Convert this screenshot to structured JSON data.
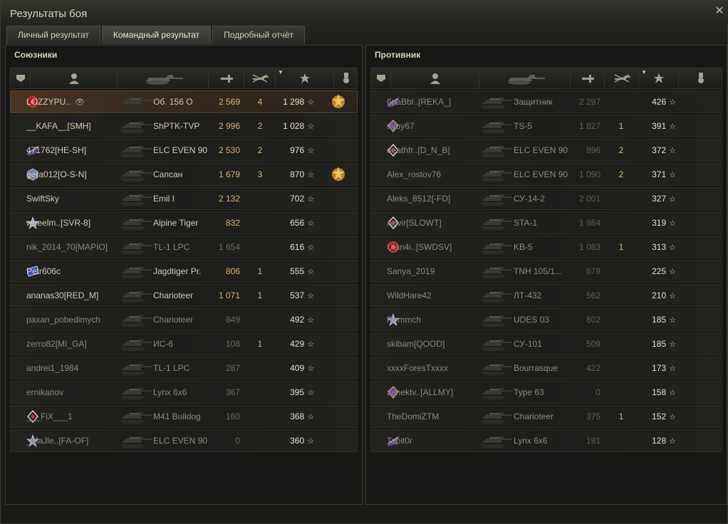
{
  "window": {
    "title": "Результаты боя",
    "close_icon": "✕"
  },
  "tabs": [
    {
      "label": "Личный результат",
      "active": false
    },
    {
      "label": "Командный результат",
      "active": true
    },
    {
      "label": "Подробный отчёт",
      "active": false
    }
  ],
  "allies": {
    "title": "Союзники",
    "rows": [
      {
        "badge": "clan-emblem-red",
        "player": "LOZZYPU..",
        "eye": true,
        "vehicle": "Об. 156 О",
        "damage": "2 569",
        "kills": "4",
        "xp": "1 298",
        "medal": true,
        "highlight": true,
        "dead": false
      },
      {
        "badge": "",
        "player": "__KAFA__[SMH]",
        "eye": false,
        "vehicle": "ShPTK-TVP",
        "damage": "2 996",
        "kills": "2",
        "xp": "1 028",
        "medal": false,
        "highlight": false,
        "dead": false
      },
      {
        "badge": "clan-emblem-wing",
        "player": "471762[HE-SH]",
        "eye": false,
        "vehicle": "ELC EVEN 90",
        "damage": "2 530",
        "kills": "2",
        "xp": "976",
        "medal": false,
        "highlight": false,
        "dead": false
      },
      {
        "badge": "clan-emblem-cube",
        "player": "gera012[O-S-N]",
        "eye": false,
        "vehicle": "Сапсан",
        "damage": "1 679",
        "kills": "3",
        "xp": "870",
        "medal": true,
        "highlight": false,
        "dead": false
      },
      {
        "badge": "",
        "player": "SwiftSky",
        "eye": false,
        "vehicle": "Emil I",
        "damage": "2 132",
        "kills": "",
        "xp": "702",
        "medal": false,
        "highlight": false,
        "dead": false
      },
      {
        "badge": "clan-emblem-star",
        "player": "wheelm..[SVR-8]",
        "eye": false,
        "vehicle": "Alpine Tiger",
        "damage": "832",
        "kills": "",
        "xp": "656",
        "medal": false,
        "highlight": false,
        "dead": false
      },
      {
        "badge": "",
        "player": "nik_2014_70[MAPIO]",
        "eye": false,
        "vehicle": "TL-1 LPC",
        "damage": "1 654",
        "kills": "",
        "xp": "616",
        "medal": false,
        "highlight": false,
        "dead": true
      },
      {
        "badge": "clan-emblem-flag",
        "player": "Petr606c",
        "eye": false,
        "vehicle": "Jagdtiger Pr.",
        "damage": "806",
        "kills": "1",
        "xp": "555",
        "medal": false,
        "highlight": false,
        "dead": false
      },
      {
        "badge": "",
        "player": "ananas30[RED_M]",
        "eye": false,
        "vehicle": "Charioteer",
        "damage": "1 071",
        "kills": "1",
        "xp": "537",
        "medal": false,
        "highlight": false,
        "dead": false
      },
      {
        "badge": "",
        "player": "paxan_pobedimych",
        "eye": false,
        "vehicle": "Charioteer",
        "damage": "849",
        "kills": "",
        "xp": "492",
        "medal": false,
        "highlight": false,
        "dead": true
      },
      {
        "badge": "",
        "player": "zerro82[MI_GA]",
        "eye": false,
        "vehicle": "ИС-6",
        "damage": "108",
        "kills": "1",
        "xp": "429",
        "medal": false,
        "highlight": false,
        "dead": true
      },
      {
        "badge": "",
        "player": "andrei1_1984",
        "eye": false,
        "vehicle": "TL-1 LPC",
        "damage": "287",
        "kills": "",
        "xp": "409",
        "medal": false,
        "highlight": false,
        "dead": true
      },
      {
        "badge": "",
        "player": "ernikanov",
        "eye": false,
        "vehicle": "Lynx 6x6",
        "damage": "367",
        "kills": "",
        "xp": "395",
        "medal": false,
        "highlight": false,
        "dead": true
      },
      {
        "badge": "clan-emblem-diamond",
        "player": "___FiX___1",
        "eye": false,
        "vehicle": "M41 Bulldog",
        "damage": "160",
        "kills": "",
        "xp": "368",
        "medal": false,
        "highlight": false,
        "dead": true
      },
      {
        "badge": "clan-emblem-star",
        "player": "_MaJle..[FA-OF]",
        "eye": false,
        "vehicle": "ELC EVEN 90",
        "damage": "0",
        "kills": "",
        "xp": "360",
        "medal": false,
        "highlight": false,
        "dead": true
      }
    ]
  },
  "enemies": {
    "title": "Противник",
    "rows": [
      {
        "badge": "clan-emblem-wing",
        "player": "6paBbl..[REKA_]",
        "eye": false,
        "vehicle": "Защитник",
        "damage": "2 297",
        "kills": "",
        "xp": "426",
        "medal": false,
        "highlight": false,
        "dead": true
      },
      {
        "badge": "clan-emblem-rank",
        "player": "uyuy67",
        "eye": false,
        "vehicle": "TS-5",
        "damage": "1 827",
        "kills": "1",
        "xp": "391",
        "medal": false,
        "highlight": false,
        "dead": true
      },
      {
        "badge": "clan-emblem-diamond",
        "player": "deathfr..[D_N_B]",
        "eye": false,
        "vehicle": "ELC EVEN 90",
        "damage": "896",
        "kills": "2",
        "xp": "372",
        "medal": false,
        "highlight": false,
        "dead": true
      },
      {
        "badge": "",
        "player": "Alex_rostov76",
        "eye": false,
        "vehicle": "ELC EVEN 90",
        "damage": "1 090",
        "kills": "2",
        "xp": "371",
        "medal": false,
        "highlight": false,
        "dead": true
      },
      {
        "badge": "",
        "player": "Aleks_8512[-FD]",
        "eye": false,
        "vehicle": "СУ-14-2",
        "damage": "2 001",
        "kills": "",
        "xp": "327",
        "medal": false,
        "highlight": false,
        "dead": true
      },
      {
        "badge": "clan-emblem-diamond",
        "player": "Agvir[SLOWT]",
        "eye": false,
        "vehicle": "STA-1",
        "damage": "1 984",
        "kills": "",
        "xp": "319",
        "medal": false,
        "highlight": false,
        "dead": true
      },
      {
        "badge": "clan-emblem-red",
        "player": "Ulan4i..[SWDSV]",
        "eye": false,
        "vehicle": "KB-5",
        "damage": "1 083",
        "kills": "1",
        "xp": "313",
        "medal": false,
        "highlight": false,
        "dead": true
      },
      {
        "badge": "",
        "player": "Sanya_2019",
        "eye": false,
        "vehicle": "TNH 105/1...",
        "damage": "678",
        "kills": "",
        "xp": "225",
        "medal": false,
        "highlight": false,
        "dead": true
      },
      {
        "badge": "",
        "player": "WildHare42",
        "eye": false,
        "vehicle": "ЛТ-432",
        "damage": "562",
        "kills": "",
        "xp": "210",
        "medal": false,
        "highlight": false,
        "dead": true
      },
      {
        "badge": "clan-emblem-star",
        "player": "Rommch",
        "eye": false,
        "vehicle": "UDES 03",
        "damage": "802",
        "kills": "",
        "xp": "185",
        "medal": false,
        "highlight": false,
        "dead": true
      },
      {
        "badge": "",
        "player": "skibam[QOOD]",
        "eye": false,
        "vehicle": "СУ-101",
        "damage": "509",
        "kills": "",
        "xp": "185",
        "medal": false,
        "highlight": false,
        "dead": true
      },
      {
        "badge": "",
        "player": "xxxxForesTxxxx",
        "eye": false,
        "vehicle": "Bourrasque",
        "damage": "422",
        "kills": "",
        "xp": "173",
        "medal": false,
        "highlight": false,
        "dead": true
      },
      {
        "badge": "clan-emblem-rank",
        "player": "zenektv..[ALLMY]",
        "eye": false,
        "vehicle": "Type 63",
        "damage": "0",
        "kills": "",
        "xp": "158",
        "medal": false,
        "highlight": false,
        "dead": true
      },
      {
        "badge": "",
        "player": "TheDomiZTM",
        "eye": false,
        "vehicle": "Charioteer",
        "damage": "375",
        "kills": "1",
        "xp": "152",
        "medal": false,
        "highlight": false,
        "dead": true
      },
      {
        "badge": "clan-emblem-wing",
        "player": "Tapit0r",
        "eye": false,
        "vehicle": "Lynx 6x6",
        "damage": "191",
        "kills": "",
        "xp": "128",
        "medal": false,
        "highlight": false,
        "dead": true
      }
    ]
  },
  "icons": {
    "star": "☆",
    "eye": "👁"
  },
  "colors": {
    "accent": "#d9b36f",
    "highlight_row": "#4a3424",
    "text": "#c8c4b4"
  }
}
